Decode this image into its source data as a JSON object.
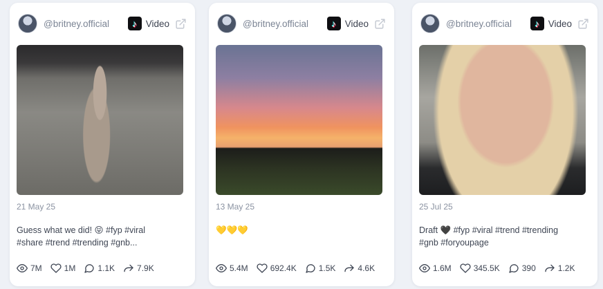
{
  "posts": [
    {
      "handle": "@britney.official",
      "platform_label": "Video",
      "date": "21 May 25",
      "caption_line1": "Guess what we did! 😝 #fyp #viral",
      "caption_line2": "#share #trend #trending #gnb...",
      "views": "7M",
      "likes": "1M",
      "comments": "1.1K",
      "shares": "7.9K"
    },
    {
      "handle": "@britney.official",
      "platform_label": "Video",
      "date": "13 May 25",
      "caption_line1": "💛💛💛",
      "caption_line2": "",
      "views": "5.4M",
      "likes": "692.4K",
      "comments": "1.5K",
      "shares": "4.6K"
    },
    {
      "handle": "@britney.official",
      "platform_label": "Video",
      "date": "25 Jul 25",
      "caption_line1": "Draft 🖤 #fyp #viral #trend #trending",
      "caption_line2": "#gnb #foryoupage",
      "views": "1.6M",
      "likes": "345.5K",
      "comments": "390",
      "shares": "1.2K"
    }
  ],
  "icons": {
    "platform": "tiktok-icon",
    "external": "external-link-icon",
    "views": "eye-icon",
    "likes": "heart-icon",
    "comments": "comment-icon",
    "shares": "share-icon"
  },
  "colors": {
    "page_bg": "#eef1f6",
    "card_bg": "#ffffff",
    "muted_text": "#8a92a1",
    "body_text": "#3e4553"
  }
}
